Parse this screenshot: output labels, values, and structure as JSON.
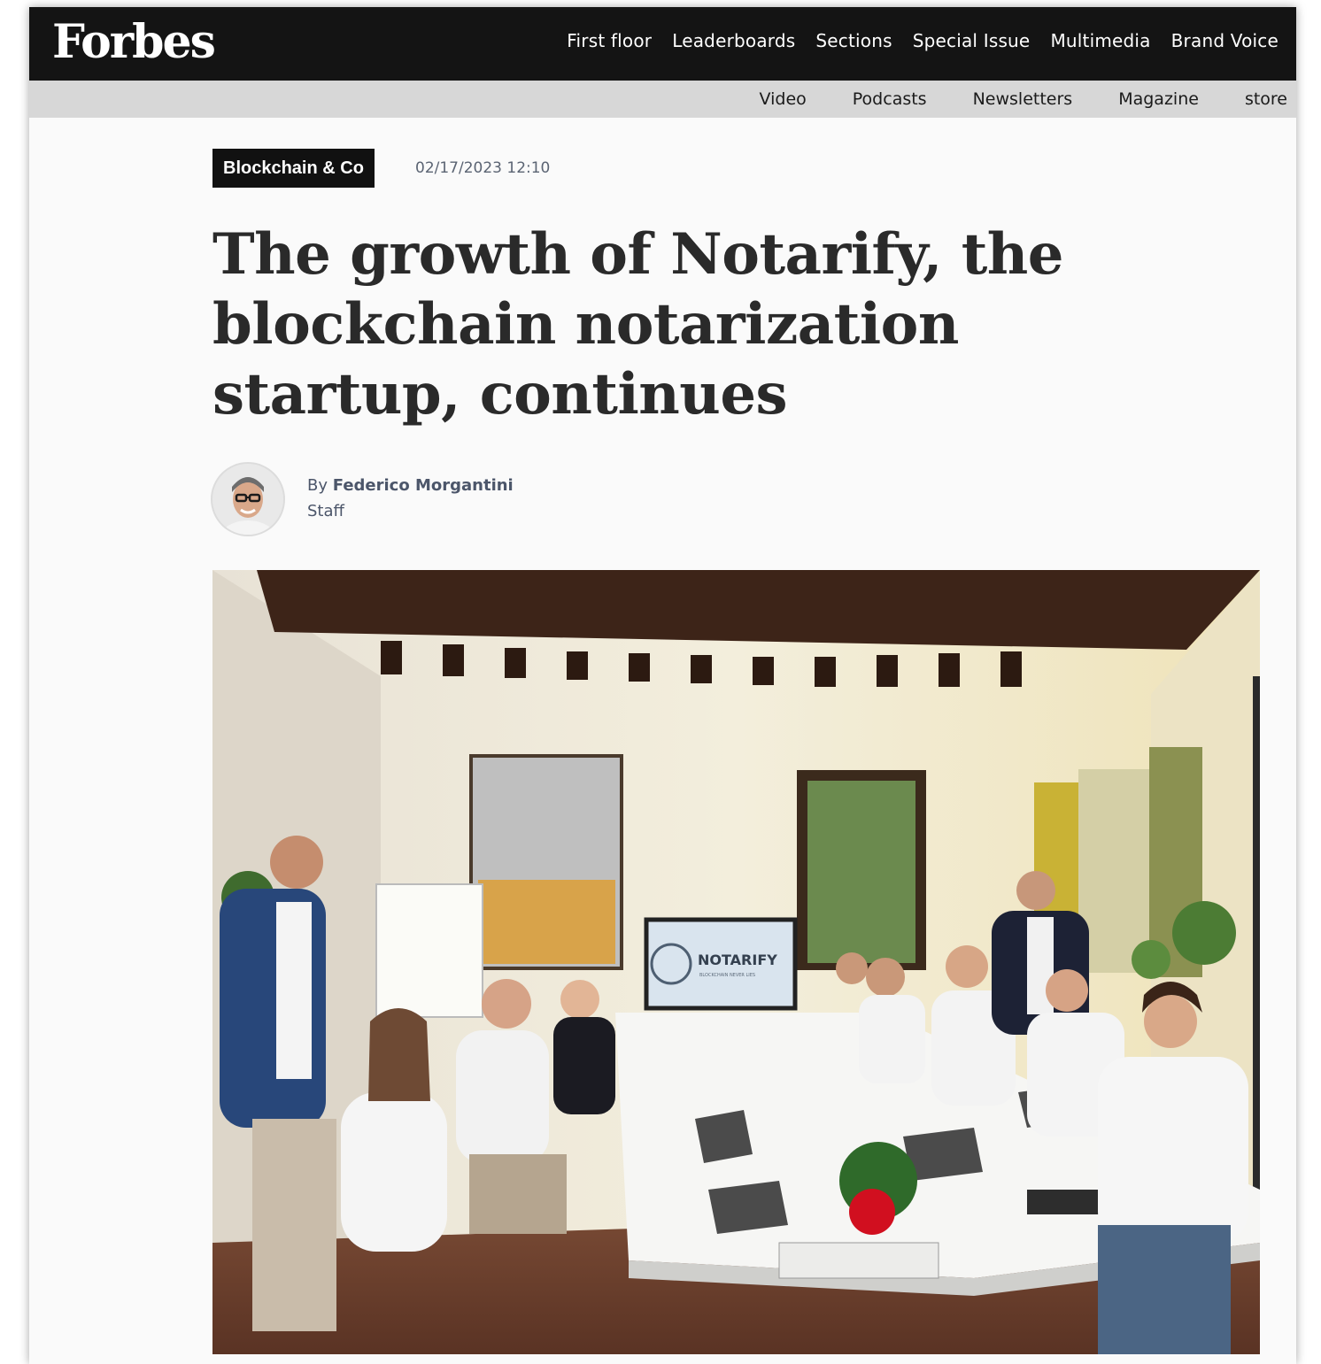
{
  "brand": {
    "logo_text": "Forbes"
  },
  "main_nav": {
    "items": [
      "First floor",
      "Leaderboards",
      "Sections",
      "Special Issue",
      "Multimedia",
      "Brand Voice"
    ]
  },
  "sub_nav": {
    "items": [
      "Video",
      "Podcasts",
      "Newsletters",
      "Magazine",
      "store"
    ]
  },
  "article": {
    "category": "Blockchain & Co",
    "date": "02/17/2023 12:10",
    "title": "The growth of Notarify, the blockchain notarization startup, continues",
    "author_prefix": "By",
    "author": "Federico Morgantini",
    "author_role": "Staff",
    "photo": {
      "screen_brand": "NOTARIFY",
      "screen_tagline": "BLOCKCHAIN NEVER LIES"
    }
  },
  "colors": {
    "topbar": "#141414",
    "subbar": "#d7d7d7",
    "badge": "#111111",
    "headline": "#2a2a2a",
    "meta": "#5b6473"
  }
}
